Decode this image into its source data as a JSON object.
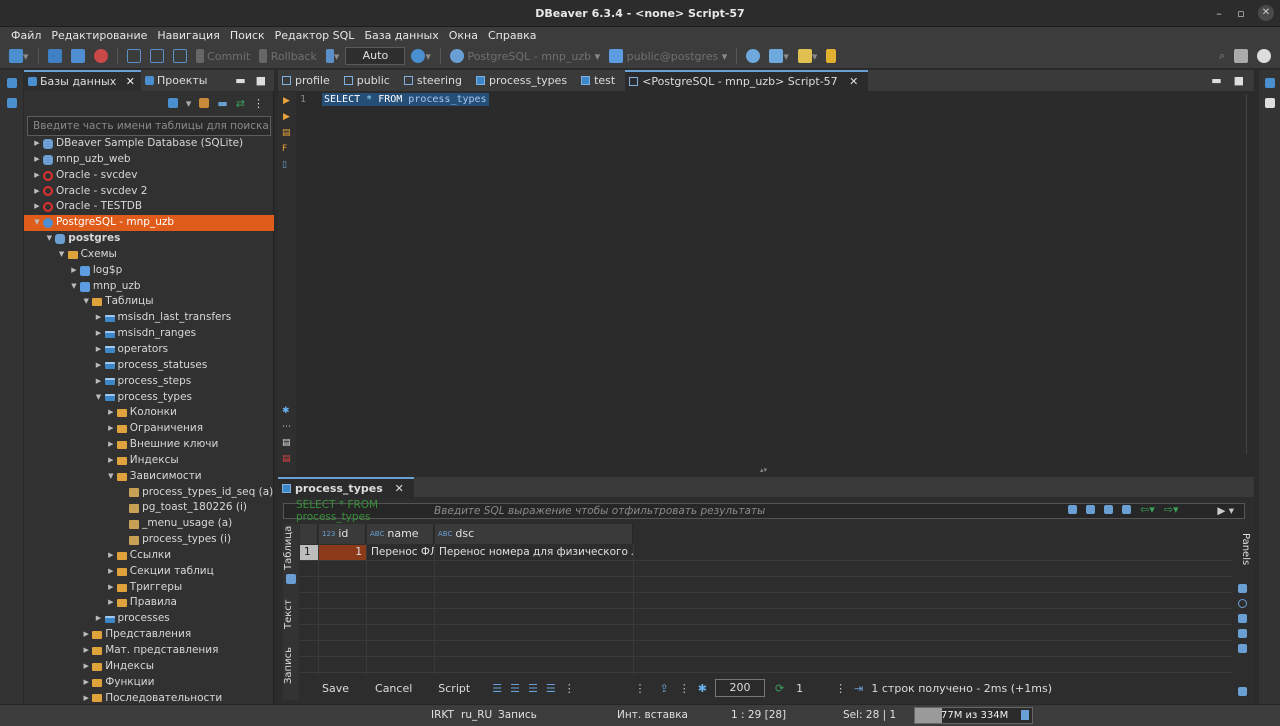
{
  "window": {
    "title": "DBeaver 6.3.4 - <none> Script-57"
  },
  "menu": [
    "Файл",
    "Редактирование",
    "Навигация",
    "Поиск",
    "Редактор SQL",
    "База данных",
    "Окна",
    "Справка"
  ],
  "toolbar": {
    "commit": "Commit",
    "rollback": "Rollback",
    "mode": "Auto",
    "connection": "PostgreSQL - mnp_uzb",
    "schema": "public@postgres"
  },
  "db_panel": {
    "tab_databases": "Базы данных",
    "tab_projects": "Проекты",
    "filter_placeholder": "Введите часть имени таблицы для поиска",
    "tree": [
      {
        "label": "DBeaver Sample Database (SQLite)",
        "level": 0,
        "icon": "db",
        "expanded": false
      },
      {
        "label": "mnp_uzb_web",
        "level": 0,
        "icon": "db",
        "expanded": false
      },
      {
        "label": "Oracle - svcdev",
        "level": 0,
        "icon": "oracle",
        "expanded": false
      },
      {
        "label": "Oracle - svcdev 2",
        "level": 0,
        "icon": "oracle",
        "expanded": false
      },
      {
        "label": "Oracle - TESTDB",
        "level": 0,
        "icon": "oracle",
        "expanded": false
      },
      {
        "label": "PostgreSQL - mnp_uzb",
        "level": 0,
        "icon": "pg",
        "expanded": true,
        "selected": true
      },
      {
        "label": "postgres",
        "level": 1,
        "icon": "db",
        "expanded": true,
        "bold": true
      },
      {
        "label": "Схемы",
        "level": 2,
        "icon": "folder",
        "expanded": true
      },
      {
        "label": "log$p",
        "level": 3,
        "icon": "schema",
        "expanded": false
      },
      {
        "label": "mnp_uzb",
        "level": 3,
        "icon": "schema",
        "expanded": true
      },
      {
        "label": "Таблицы",
        "level": 4,
        "icon": "folder",
        "expanded": true
      },
      {
        "label": "msisdn_last_transfers",
        "level": 5,
        "icon": "table",
        "expanded": false
      },
      {
        "label": "msisdn_ranges",
        "level": 5,
        "icon": "table",
        "expanded": false
      },
      {
        "label": "operators",
        "level": 5,
        "icon": "table",
        "expanded": false
      },
      {
        "label": "process_statuses",
        "level": 5,
        "icon": "table",
        "expanded": false
      },
      {
        "label": "process_steps",
        "level": 5,
        "icon": "table",
        "expanded": false
      },
      {
        "label": "process_types",
        "level": 5,
        "icon": "table",
        "expanded": true
      },
      {
        "label": "Колонки",
        "level": 6,
        "icon": "folder",
        "expanded": false
      },
      {
        "label": "Ограничения",
        "level": 6,
        "icon": "folder",
        "expanded": false
      },
      {
        "label": "Внешние ключи",
        "level": 6,
        "icon": "folder",
        "expanded": false
      },
      {
        "label": "Индексы",
        "level": 6,
        "icon": "folder",
        "expanded": false
      },
      {
        "label": "Зависимости",
        "level": 6,
        "icon": "folder",
        "expanded": true
      },
      {
        "label": "process_types_id_seq (a)",
        "level": 7,
        "icon": "seq",
        "leaf": true
      },
      {
        "label": "pg_toast_180226 (i)",
        "level": 7,
        "icon": "seq",
        "leaf": true
      },
      {
        "label": "_menu_usage (a)",
        "level": 7,
        "icon": "seq",
        "leaf": true
      },
      {
        "label": "process_types (i)",
        "level": 7,
        "icon": "seq",
        "leaf": true
      },
      {
        "label": "Ссылки",
        "level": 6,
        "icon": "folder",
        "expanded": false
      },
      {
        "label": "Секции таблиц",
        "level": 6,
        "icon": "folder",
        "expanded": false
      },
      {
        "label": "Триггеры",
        "level": 6,
        "icon": "folder",
        "expanded": false
      },
      {
        "label": "Правила",
        "level": 6,
        "icon": "folder",
        "expanded": false
      },
      {
        "label": "processes",
        "level": 5,
        "icon": "table",
        "expanded": false
      },
      {
        "label": "Представления",
        "level": 4,
        "icon": "folder",
        "expanded": false
      },
      {
        "label": "Мат. представления",
        "level": 4,
        "icon": "folder",
        "expanded": false
      },
      {
        "label": "Индексы",
        "level": 4,
        "icon": "folder",
        "expanded": false
      },
      {
        "label": "Функции",
        "level": 4,
        "icon": "folder",
        "expanded": false
      },
      {
        "label": "Последовательности",
        "level": 4,
        "icon": "folder",
        "expanded": false
      }
    ]
  },
  "editor": {
    "tabs": [
      "profile",
      "public",
      "steering",
      "process_types",
      "test",
      "<PostgreSQL - mnp_uzb> Script-57"
    ],
    "line_number": "1",
    "sql": {
      "kw1": "SELECT",
      "star": " * ",
      "kw2": "FROM",
      "table": " process_types"
    }
  },
  "results": {
    "tab": "process_types",
    "filter_query": "SELECT * FROM process_types",
    "filter_placeholder": "Введите SQL выражение чтобы отфильтровать результаты",
    "side_tabs": [
      "Таблица",
      "Текст",
      "Запись"
    ],
    "columns": [
      {
        "type": "123",
        "name": "id"
      },
      {
        "type": "ABC",
        "name": "name"
      },
      {
        "type": "ABC",
        "name": "dsc"
      }
    ],
    "rows": [
      {
        "num": "1",
        "id": "1",
        "name": "Перенос ФЛ",
        "dsc": "Перенос номера для физического лица"
      }
    ],
    "save": "Save",
    "cancel": "Cancel",
    "script": "Script",
    "fetch_size": "200",
    "count": "1",
    "status": "1 строк получено - 2ms (+1ms)",
    "panels": "Panels"
  },
  "statusbar": {
    "tz": "IRKT",
    "locale": "ru_RU",
    "mode": "Запись",
    "insert": "Инт. вставка",
    "pos": "1 : 29 [28]",
    "sel": "Sel: 28 | 1",
    "memory": "77M из 334M",
    "memory_fraction": 0.23
  }
}
